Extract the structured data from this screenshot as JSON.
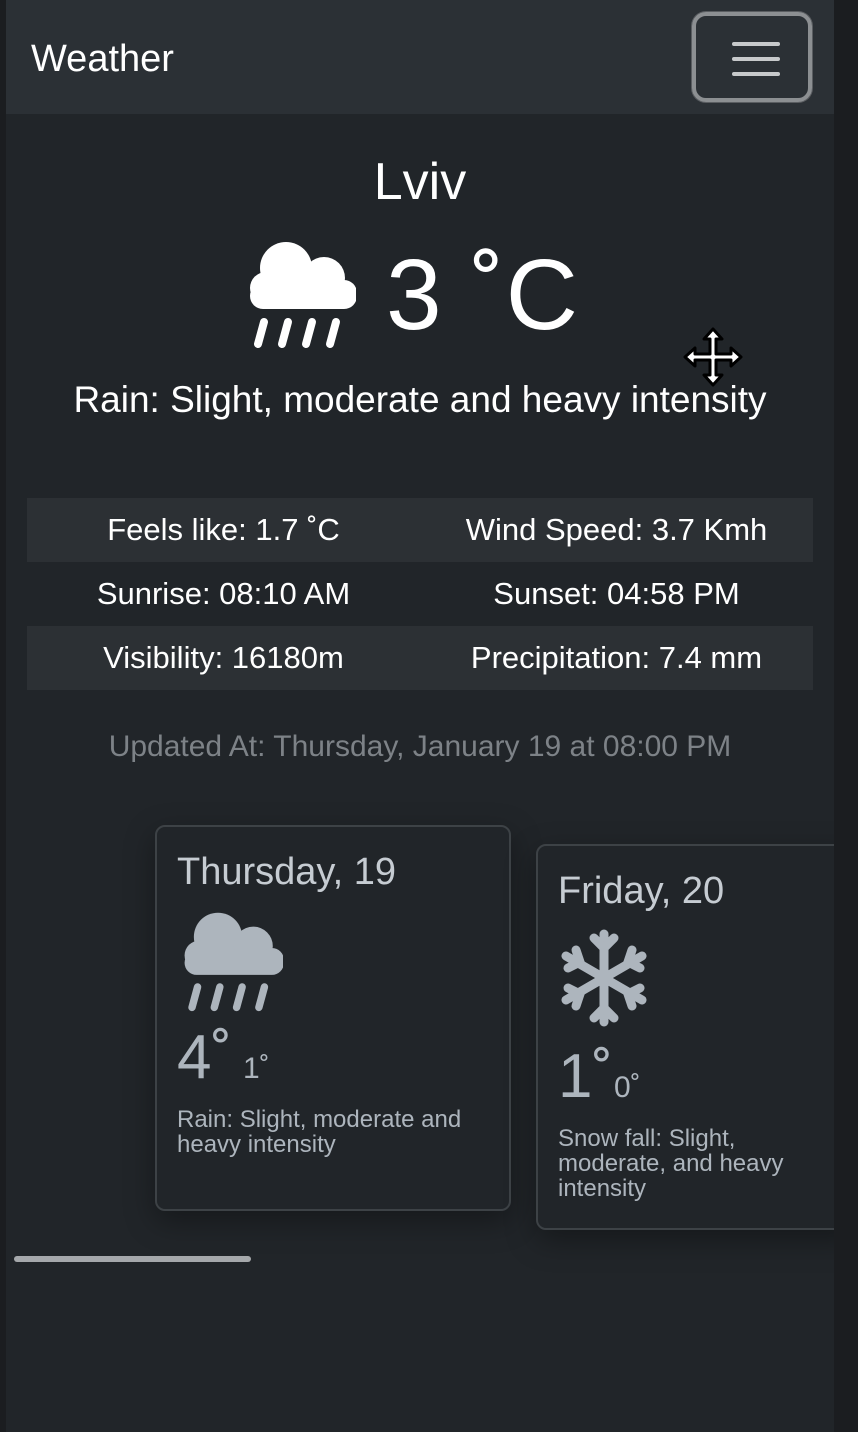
{
  "navbar": {
    "brand": "Weather",
    "toggler_icon": "hamburger-menu-icon"
  },
  "current": {
    "city": "Lviv",
    "icon": "rain-cloud-icon",
    "temperature": "3 ˚C",
    "summary": "Rain: Slight, moderate and heavy intensity",
    "details": [
      [
        "Feels like: 1.7 ˚C",
        "Wind Speed: 3.7 Kmh"
      ],
      [
        "Sunrise: 08:10 AM",
        "Sunset: 04:58 PM"
      ],
      [
        "Visibility: 16180m",
        "Precipitation: 7.4 mm"
      ]
    ],
    "updated": "Updated At: Thursday, January 19 at 08:00 PM"
  },
  "forecast": [
    {
      "day": "Thursday, 19",
      "icon": "rain-cloud-icon",
      "high": "4˚",
      "low": "1˚",
      "description": "Rain: Slight, moderate and heavy intensity"
    },
    {
      "day": "Friday, 20",
      "icon": "snowflake-icon",
      "high": "1˚",
      "low": "0˚",
      "description": "Snow fall: Slight, moderate, and heavy intensity"
    }
  ],
  "colors": {
    "page_bg": "#212529",
    "navbar_bg": "#2b3035",
    "stripe_bg": "#2c3034",
    "muted_text": "#7d8287",
    "card_text": "#adb5bd"
  }
}
